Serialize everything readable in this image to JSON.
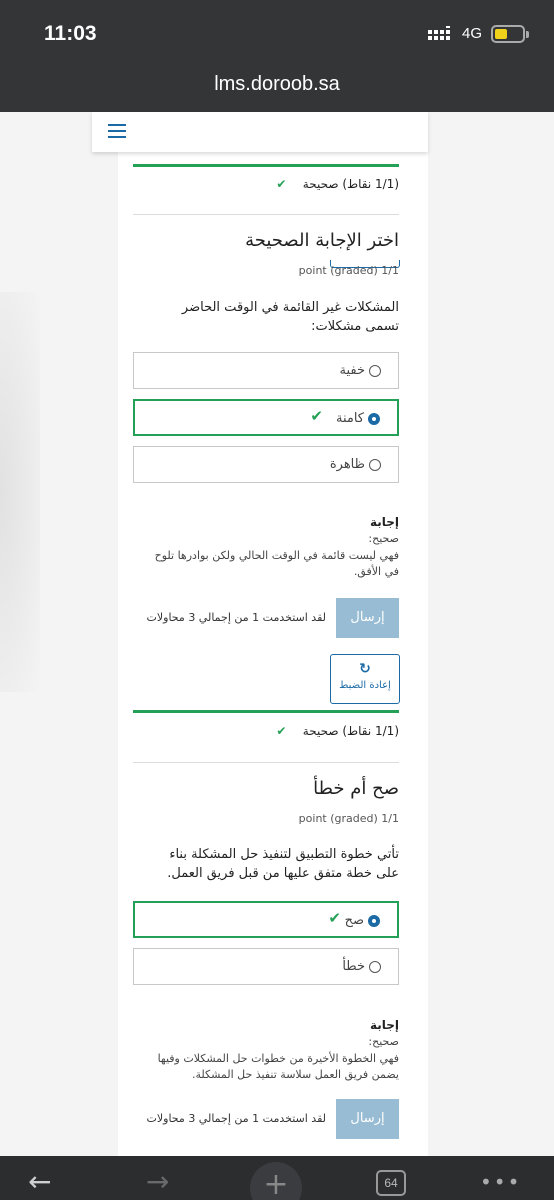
{
  "status_bar": {
    "time": "11:03",
    "network": "4G"
  },
  "browser": {
    "url": "lms.doroob.sa",
    "tab_count": "64"
  },
  "top_question": {
    "score": "(1/1 نقاط) صحيحة"
  },
  "question1": {
    "title": "اختر الإجابة الصحيحة",
    "graded": "1/1 point (graded)",
    "prompt": "المشكلات غير القائمة في الوقت الحاضر تسمى مشكلات:",
    "options": [
      {
        "label": "خفية",
        "selected": false,
        "correct": false
      },
      {
        "label": "كامنة",
        "selected": true,
        "correct": true
      },
      {
        "label": "ظاهرة",
        "selected": false,
        "correct": false
      }
    ],
    "answer_heading": "إجابة",
    "answer_status": "صحيح:",
    "answer_text": "فهي ليست قائمة في الوقت الحالي ولكن بوادرها تلوح في الأفق.",
    "submit_label": "إرسال",
    "attempts_text": "لقد استخدمت 1 من إجمالي 3 محاولات",
    "reset_label": "إعادة الضبط",
    "reset_icon": "refresh-icon",
    "score": "(1/1 نقاط) صحيحة"
  },
  "question2": {
    "title": "صح أم خطأ",
    "graded": "1/1 point (graded)",
    "prompt": "تأتي خطوة التطبيق لتنفيذ حل المشكلة بناء على خطة متفق عليها من قبل فريق العمل.",
    "options": [
      {
        "label": "صح",
        "selected": true,
        "correct": true
      },
      {
        "label": "خطأ",
        "selected": false,
        "correct": false
      }
    ],
    "answer_heading": "إجابة",
    "answer_status": "صحيح:",
    "answer_text": "فهي الخطوة الأخيرة من خطوات حل المشكلات وفيها يضمن فريق العمل سلاسة تنفيذ حل المشكلة.",
    "submit_label": "إرسال",
    "attempts_text": "لقد استخدمت 1 من إجمالي 3 محاولات"
  },
  "colors": {
    "correct_green": "#24a157",
    "link_blue": "#1b6aa5",
    "submit_disabled": "#97bcd3"
  }
}
